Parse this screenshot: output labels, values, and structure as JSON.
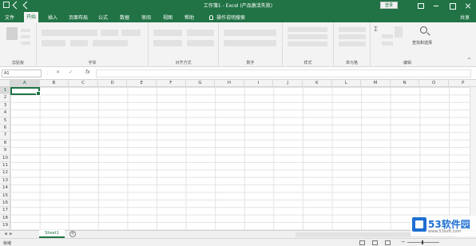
{
  "titlebar": {
    "title": "工作簿1 - Excel (产品激活失败)",
    "login": "登录",
    "quick_access": [
      "save-icon",
      "undo-icon",
      "redo-icon"
    ],
    "brand_color": "#217346"
  },
  "tabs": [
    {
      "label": "文件",
      "active": false
    },
    {
      "label": "开始",
      "active": true
    },
    {
      "label": "插入",
      "active": false
    },
    {
      "label": "页面布局",
      "active": false
    },
    {
      "label": "公式",
      "active": false
    },
    {
      "label": "数据",
      "active": false
    },
    {
      "label": "审阅",
      "active": false
    },
    {
      "label": "视图",
      "active": false
    },
    {
      "label": "帮助",
      "active": false
    }
  ],
  "tell_me": "操作说明搜索",
  "share": "共享",
  "ribbon": {
    "groups": [
      {
        "label": "剪贴板"
      },
      {
        "label": "字体"
      },
      {
        "label": "对齐方式"
      },
      {
        "label": "数字"
      },
      {
        "label": "样式"
      },
      {
        "label": "单元格"
      },
      {
        "label": "编辑"
      }
    ],
    "find_label": "查找和选择"
  },
  "formula_bar": {
    "name_box": "A1",
    "fx": "fx",
    "value": ""
  },
  "grid": {
    "columns": [
      "A",
      "B",
      "C",
      "D",
      "E",
      "F",
      "G",
      "H",
      "I",
      "J",
      "K",
      "L",
      "M",
      "N",
      "O",
      "P"
    ],
    "rows": [
      "1",
      "2",
      "3",
      "4",
      "5",
      "6",
      "7",
      "8",
      "9",
      "10",
      "11",
      "12",
      "13",
      "14",
      "15",
      "16",
      "17",
      "18",
      "19"
    ],
    "active_column": "A",
    "active_row": "1"
  },
  "sheets": [
    {
      "label": "Sheet1",
      "active": true
    }
  ],
  "status": {
    "text": "就绪"
  },
  "watermark": {
    "brand": "53软件园",
    "url": "www.53soft.com"
  }
}
